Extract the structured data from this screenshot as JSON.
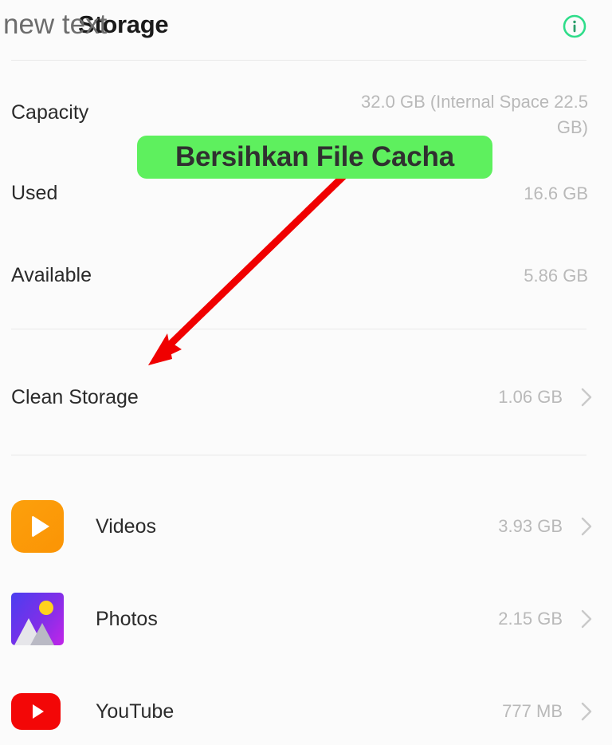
{
  "header": {
    "title": "Storage",
    "overlay_text": "new text",
    "info_icon": "info-circle-icon",
    "info_icon_color": "#2fdd8a"
  },
  "storage_info": [
    {
      "label": "Capacity",
      "value": "32.0 GB (Internal Space 22.5 GB)"
    },
    {
      "label": "Used",
      "value": "16.6 GB"
    },
    {
      "label": "Available",
      "value": "5.86 GB"
    }
  ],
  "clean_storage": {
    "label": "Clean Storage",
    "value": "1.06 GB",
    "chevron": "chevron-right-icon"
  },
  "categories": [
    {
      "label": "Videos",
      "value": "3.93 GB",
      "icon": "videos-play-icon",
      "chevron": "chevron-right-icon"
    },
    {
      "label": "Photos",
      "value": "2.15 GB",
      "icon": "photos-gallery-icon",
      "chevron": "chevron-right-icon"
    },
    {
      "label": "YouTube",
      "value": "777 MB",
      "icon": "youtube-icon",
      "chevron": "chevron-right-icon"
    }
  ],
  "annotation": {
    "banner_text": "Bersihkan File Cacha",
    "banner_color": "#5ef05e",
    "arrow_color": "#f00000",
    "arrow_name": "red-annotation-arrow"
  }
}
